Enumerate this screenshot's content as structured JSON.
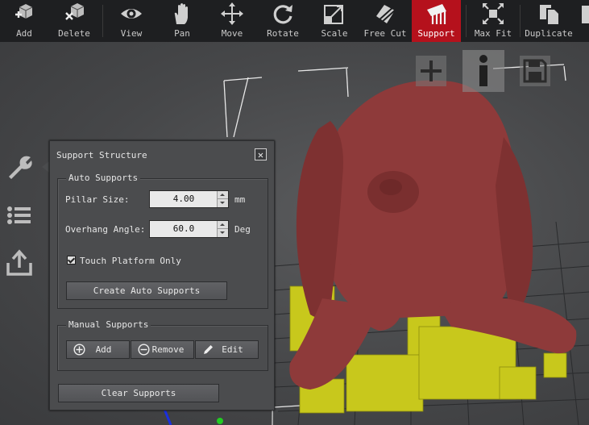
{
  "toolbar": {
    "items": [
      {
        "label": "Add",
        "icon": "add-model-icon"
      },
      {
        "label": "Delete",
        "icon": "delete-model-icon"
      },
      {
        "label": "View",
        "icon": "eye-icon"
      },
      {
        "label": "Pan",
        "icon": "hand-icon"
      },
      {
        "label": "Move",
        "icon": "move-arrows-icon"
      },
      {
        "label": "Rotate",
        "icon": "rotate-icon"
      },
      {
        "label": "Scale",
        "icon": "scale-icon"
      },
      {
        "label": "Free Cut",
        "icon": "free-cut-icon"
      },
      {
        "label": "Support",
        "icon": "support-icon",
        "active": true
      },
      {
        "label": "Max Fit",
        "icon": "max-fit-icon"
      },
      {
        "label": "Duplicate",
        "icon": "duplicate-icon"
      }
    ],
    "active_color": "#b5111c"
  },
  "leftbar": {
    "icons": [
      "wrench-icon",
      "list-icon",
      "export-icon"
    ]
  },
  "viewport_overlay": {
    "icons": [
      "zoom-plus-icon",
      "info-icon",
      "save-icon"
    ]
  },
  "support_panel": {
    "title": "Support Structure",
    "close_symbol": "✕",
    "auto": {
      "title": "Auto Supports",
      "pillar_label": "Pillar Size:",
      "pillar_value": "4.00",
      "pillar_unit": "mm",
      "angle_label": "Overhang Angle:",
      "angle_value": "60.0",
      "angle_unit": "Deg",
      "touch_label": "Touch Platform Only",
      "touch_checked": true,
      "create_label": "Create Auto Supports"
    },
    "manual": {
      "title": "Manual Supports",
      "add_label": "Add",
      "remove_label": "Remove",
      "edit_label": "Edit"
    },
    "clear_label": "Clear Supports"
  },
  "colors": {
    "model": "#8e3a3a",
    "supports": "#c8c81c"
  }
}
